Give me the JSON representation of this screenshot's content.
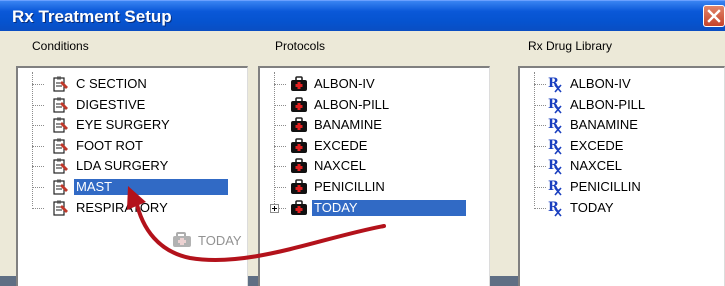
{
  "window": {
    "title": "Rx Treatment Setup",
    "close_icon": "close-icon"
  },
  "conditions": {
    "label": "Conditions",
    "items": [
      {
        "label": "C SECTION",
        "icon": "condition-icon"
      },
      {
        "label": "DIGESTIVE",
        "icon": "condition-icon"
      },
      {
        "label": "EYE SURGERY",
        "icon": "condition-icon"
      },
      {
        "label": "FOOT ROT",
        "icon": "condition-icon"
      },
      {
        "label": "LDA SURGERY",
        "icon": "condition-icon"
      },
      {
        "label": "MAST",
        "icon": "condition-icon",
        "selected": true
      },
      {
        "label": "RESPIRATORY",
        "icon": "condition-icon"
      }
    ]
  },
  "protocols": {
    "label": "Protocols",
    "items": [
      {
        "label": "ALBON-IV",
        "icon": "medkit-icon"
      },
      {
        "label": "ALBON-PILL",
        "icon": "medkit-icon"
      },
      {
        "label": "BANAMINE",
        "icon": "medkit-icon"
      },
      {
        "label": "EXCEDE",
        "icon": "medkit-icon"
      },
      {
        "label": "NAXCEL",
        "icon": "medkit-icon"
      },
      {
        "label": "PENICILLIN",
        "icon": "medkit-icon"
      },
      {
        "label": "TODAY",
        "icon": "medkit-icon",
        "selected": true,
        "expandable": true
      }
    ]
  },
  "drug_library": {
    "label": "Rx Drug Library",
    "items": [
      {
        "label": "ALBON-IV",
        "icon": "rx-icon"
      },
      {
        "label": "ALBON-PILL",
        "icon": "rx-icon"
      },
      {
        "label": "BANAMINE",
        "icon": "rx-icon"
      },
      {
        "label": "EXCEDE",
        "icon": "rx-icon"
      },
      {
        "label": "NAXCEL",
        "icon": "rx-icon"
      },
      {
        "label": "PENICILLIN",
        "icon": "rx-icon"
      },
      {
        "label": "TODAY",
        "icon": "rx-icon"
      }
    ]
  },
  "drag": {
    "ghost_label": "TODAY",
    "icon": "medkit-icon",
    "arrow_color": "#b3121b"
  },
  "colors": {
    "titlebar": "#0a58d8",
    "selection": "#316ac5",
    "window_bg": "#ece9d8"
  }
}
